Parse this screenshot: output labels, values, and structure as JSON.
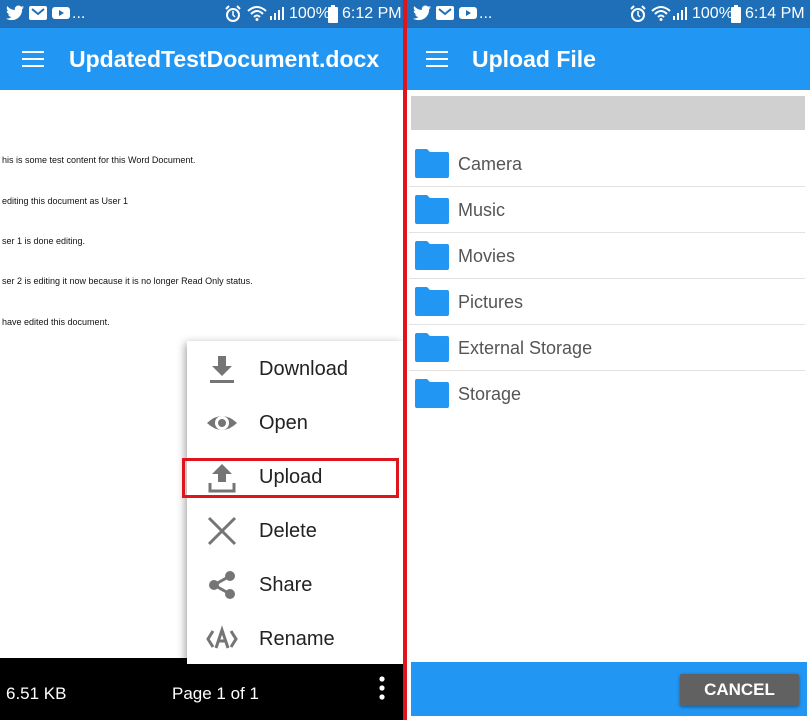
{
  "left_screen": {
    "status_bar": {
      "ellipsis": "...",
      "battery": "100%",
      "time": "6:12 PM"
    },
    "app_bar": {
      "title": "UpdatedTestDocument.docx",
      "menu_icon": "hamburger-menu-icon"
    },
    "document": {
      "lines": [
        "his is some test content for this Word Document.",
        "editing this document as User 1",
        "ser 1 is done editing.",
        "ser 2 is editing it now because it is no longer Read Only status.",
        "have edited this document."
      ]
    },
    "context_menu": {
      "items": [
        {
          "label": "Download",
          "icon": "download-icon"
        },
        {
          "label": "Open",
          "icon": "eye-icon"
        },
        {
          "label": "Upload",
          "icon": "upload-icon",
          "highlighted": true
        },
        {
          "label": "Delete",
          "icon": "close-x-icon"
        },
        {
          "label": "Share",
          "icon": "share-icon"
        },
        {
          "label": "Rename",
          "icon": "rename-icon"
        }
      ]
    },
    "bottom_bar": {
      "file_size": "6.51 KB",
      "page_indicator": "Page 1 of 1",
      "more_icon": "more-vert-icon"
    }
  },
  "right_screen": {
    "status_bar": {
      "ellipsis": "...",
      "battery": "100%",
      "time": "6:14 PM"
    },
    "app_bar": {
      "title": "Upload File",
      "menu_icon": "hamburger-menu-icon"
    },
    "folders": [
      {
        "label": "Camera",
        "icon": "folder-icon"
      },
      {
        "label": "Music",
        "icon": "folder-icon"
      },
      {
        "label": "Movies",
        "icon": "folder-icon"
      },
      {
        "label": "Pictures",
        "icon": "folder-icon"
      },
      {
        "label": "External Storage",
        "icon": "folder-icon"
      },
      {
        "label": "Storage",
        "icon": "folder-icon"
      }
    ],
    "cancel_label": "CANCEL"
  },
  "colors": {
    "app_bar": "#2196f3",
    "status_bar": "#1e6fb8",
    "folder": "#2196f3",
    "highlight": "#e0141c",
    "cancel_button": "#616161"
  }
}
